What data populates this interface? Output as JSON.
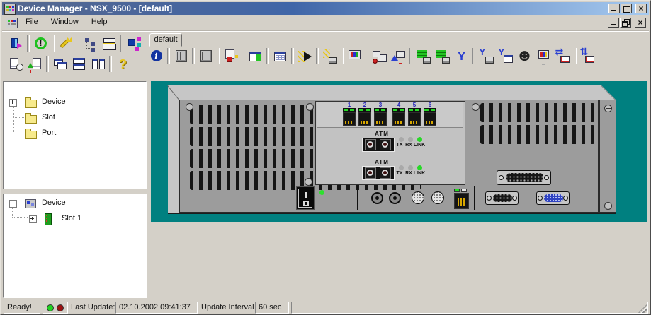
{
  "window": {
    "title": "Device Manager - NSX_9500 - [default]"
  },
  "menu": {
    "items": [
      "File",
      "Window",
      "Help"
    ]
  },
  "tabs": {
    "active": "default"
  },
  "toolbar_left": {
    "row1": [
      "device-login",
      "|",
      "status",
      "|",
      "configure-wrench",
      "|",
      "tree-view",
      "server-list",
      "|",
      "topology"
    ],
    "row2": [
      "log-clock",
      "update-document",
      "|",
      "cascade-windows",
      "tile-horizontal",
      "tile-vertical",
      "|",
      "help"
    ]
  },
  "toolbar_main": {
    "icons": [
      "info",
      "|",
      "chassis-view",
      "|",
      "chassis-view-2",
      "|",
      "connection-setup",
      "|",
      "port-table-green",
      "|",
      "port-table",
      "|",
      "power-arrow",
      "|",
      "port-power",
      "|",
      "terminal",
      "|",
      "session-monitors",
      "session-upload",
      "|",
      "vlan-green",
      "vlan-green-2",
      "y-cable",
      "|",
      "y-cable-port",
      "y-cable-table",
      "operator",
      "workstation",
      "transfer-clock",
      "|",
      "transfer-clock-upload"
    ]
  },
  "sidebar_top": {
    "items": [
      {
        "label": "Device",
        "expand": "+",
        "icon": "folder",
        "indent": 0
      },
      {
        "label": "Slot",
        "expand": null,
        "icon": "folder",
        "indent": 0
      },
      {
        "label": "Port",
        "expand": null,
        "icon": "folder",
        "indent": 0
      }
    ]
  },
  "sidebar_bottom": {
    "items": [
      {
        "label": "Device",
        "expand": "-",
        "icon": "devnet",
        "indent": 0
      },
      {
        "label": "Slot 1",
        "expand": "+",
        "icon": "slotcard",
        "indent": 1
      }
    ]
  },
  "device_view": {
    "port_numbers": [
      "1",
      "2",
      "3",
      "4",
      "5",
      "6"
    ],
    "modules": [
      {
        "label": "ATM",
        "leds": [
          {
            "label": "TX",
            "color": "#a9a9a9"
          },
          {
            "label": "RX",
            "color": "#a9a9a9"
          },
          {
            "label": "LINK",
            "color": "#28d828"
          }
        ]
      },
      {
        "label": "ATM",
        "leds": [
          {
            "label": "TX",
            "color": "#a9a9a9"
          },
          {
            "label": "RX",
            "color": "#a9a9a9"
          },
          {
            "label": "LINK",
            "color": "#28d828"
          }
        ]
      }
    ],
    "port_led_color": "#26d826",
    "power_led_color": "#2de12d",
    "rj45_led_color": "#22dd22"
  },
  "status_bar": {
    "ready": "Ready!",
    "last_update_label": "Last Update:",
    "last_update_value": "02.10.2002 09:41:37",
    "interval_label": "Update Interval",
    "interval_value": "60 sec",
    "led_colors": [
      "#21d121",
      "#9b1111"
    ]
  },
  "colors": {
    "canvas": "#008080",
    "title_from": "#55678e",
    "title_mid": "#4066a8",
    "title_to": "#a6caf0"
  }
}
